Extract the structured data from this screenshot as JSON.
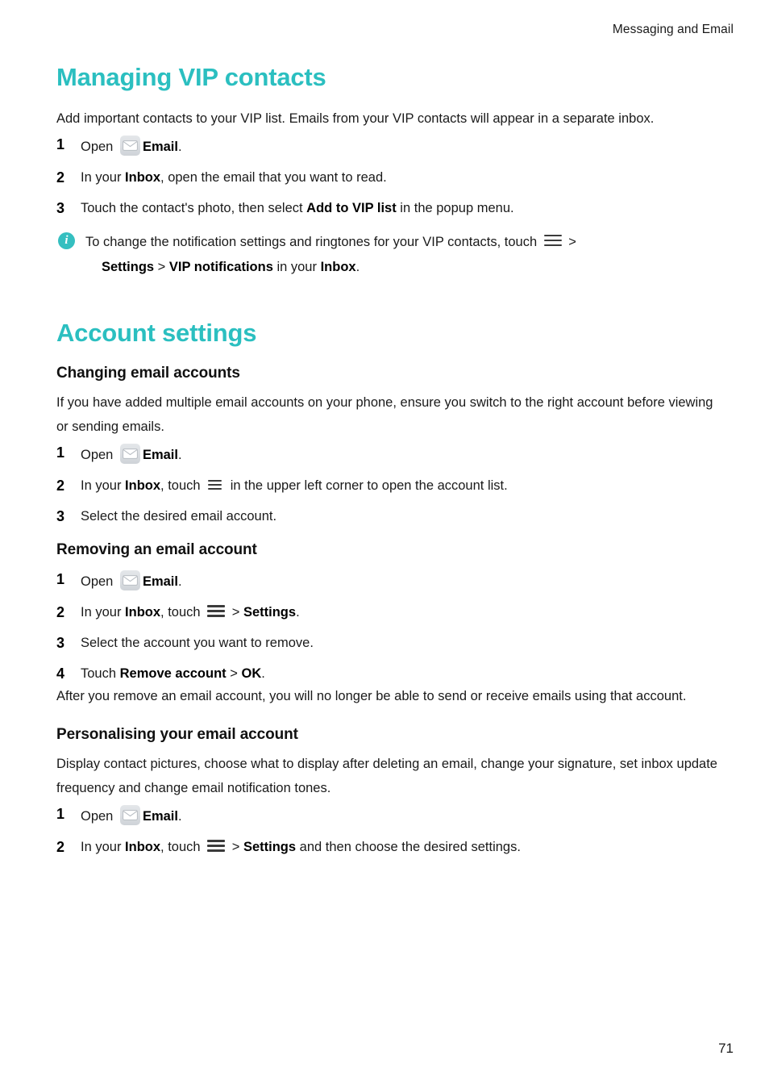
{
  "header": {
    "running_title": "Messaging and Email"
  },
  "sections": [
    {
      "title": "Managing VIP contacts",
      "intro": "Add important contacts to your VIP list. Emails from your VIP contacts will appear in a separate inbox.",
      "steps": [
        {
          "num": "1",
          "pre": "Open ",
          "icon": "email-app-icon",
          "bold1": "Email",
          "post": "."
        },
        {
          "num": "2",
          "pre": "In your ",
          "bold1": "Inbox",
          "post": ", open the email that you want to read."
        },
        {
          "num": "3",
          "pre": "Touch the contact's photo, then select ",
          "bold1": "Add to VIP list",
          "post": " in the popup menu."
        }
      ],
      "callout": {
        "icon": "info-icon",
        "icon_glyph": "i",
        "line1_pre": "To change the notification settings and ringtones for your VIP contacts, touch ",
        "line1_post": " >",
        "line2_bold1": "Settings",
        "line2_sep": " > ",
        "line2_bold2": "VIP notifications",
        "line2_mid": " in your ",
        "line2_bold3": "Inbox",
        "line2_end": "."
      }
    },
    {
      "title": "Account settings",
      "subsections": [
        {
          "heading": "Changing email accounts",
          "intro": "If you have added multiple email accounts on your phone, ensure you switch to the right account before viewing or sending emails.",
          "steps": [
            {
              "num": "1",
              "pre": "Open ",
              "icon": "email-app-icon",
              "bold1": "Email",
              "post": "."
            },
            {
              "num": "2",
              "pre": "In your ",
              "bold1": "Inbox",
              "mid": ", touch ",
              "icon": "menu-icon",
              "post": " in the upper left corner to open the account list."
            },
            {
              "num": "3",
              "pre": "Select the desired email account."
            }
          ]
        },
        {
          "heading": "Removing an email account",
          "steps": [
            {
              "num": "1",
              "pre": "Open ",
              "icon": "email-app-icon",
              "bold1": "Email",
              "post": "."
            },
            {
              "num": "2",
              "pre": "In your ",
              "bold1": "Inbox",
              "mid": ", touch ",
              "icon": "menu-icon",
              "sep": " > ",
              "bold2": "Settings",
              "post": "."
            },
            {
              "num": "3",
              "pre": "Select the account you want to remove."
            },
            {
              "num": "4",
              "pre": "Touch ",
              "bold1": "Remove account",
              "sep": " > ",
              "bold2": "OK",
              "post": "."
            }
          ],
          "note": "After you remove an email account, you will no longer be able to send or receive emails using that account."
        },
        {
          "heading": "Personalising your email account",
          "intro": "Display contact pictures, choose what to display after deleting an email, change your signature, set inbox update frequency and change email notification tones.",
          "steps": [
            {
              "num": "1",
              "pre": "Open ",
              "icon": "email-app-icon",
              "bold1": "Email",
              "post": "."
            },
            {
              "num": "2",
              "pre": "In your ",
              "bold1": "Inbox",
              "mid": ", touch ",
              "icon": "menu-icon",
              "sep": " > ",
              "bold2": "Settings",
              "post": " and then choose the desired settings."
            }
          ]
        }
      ]
    }
  ],
  "footer": {
    "page_number": "71"
  },
  "colors": {
    "heading_teal": "#2bbfc0",
    "info_badge": "#35bfc0",
    "body_text": "#1a1a1a"
  }
}
